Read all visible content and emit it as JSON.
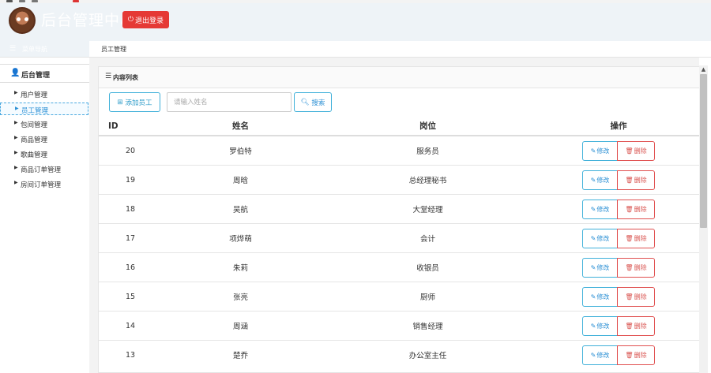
{
  "header": {
    "title": "后台管理中心",
    "logout_label": "退出登录",
    "logout_icon": "power-icon"
  },
  "subbar": {
    "menu_label": "菜单导航",
    "breadcrumb": "员工管理"
  },
  "sidebar": {
    "heading": "后台管理",
    "items": [
      {
        "label": "用户管理",
        "active": false
      },
      {
        "label": "员工管理",
        "active": true
      },
      {
        "label": "包间管理",
        "active": false
      },
      {
        "label": "商品管理",
        "active": false
      },
      {
        "label": "歌曲管理",
        "active": false
      },
      {
        "label": "商品订单管理",
        "active": false
      },
      {
        "label": "房间订单管理",
        "active": false
      }
    ]
  },
  "panel": {
    "title": "内容列表",
    "add_label": "添加员工",
    "search_placeholder": "请输入姓名",
    "search_label": "搜索"
  },
  "table": {
    "columns": [
      "ID",
      "姓名",
      "岗位",
      "操作"
    ],
    "edit_label": "修改",
    "delete_label": "删除",
    "rows": [
      {
        "id": "20",
        "name": "罗伯特",
        "position": "服务员"
      },
      {
        "id": "19",
        "name": "周晗",
        "position": "总经理秘书"
      },
      {
        "id": "18",
        "name": "吴航",
        "position": "大堂经理"
      },
      {
        "id": "17",
        "name": "项烨萌",
        "position": "会计"
      },
      {
        "id": "16",
        "name": "朱莉",
        "position": "收银员"
      },
      {
        "id": "15",
        "name": "张亮",
        "position": "厨师"
      },
      {
        "id": "14",
        "name": "周涵",
        "position": "销售经理"
      },
      {
        "id": "13",
        "name": "楚乔",
        "position": "办公室主任"
      }
    ]
  },
  "colors": {
    "accent": "#3fb0d9",
    "danger": "#e53935",
    "header_bg": "#eef3f7"
  }
}
